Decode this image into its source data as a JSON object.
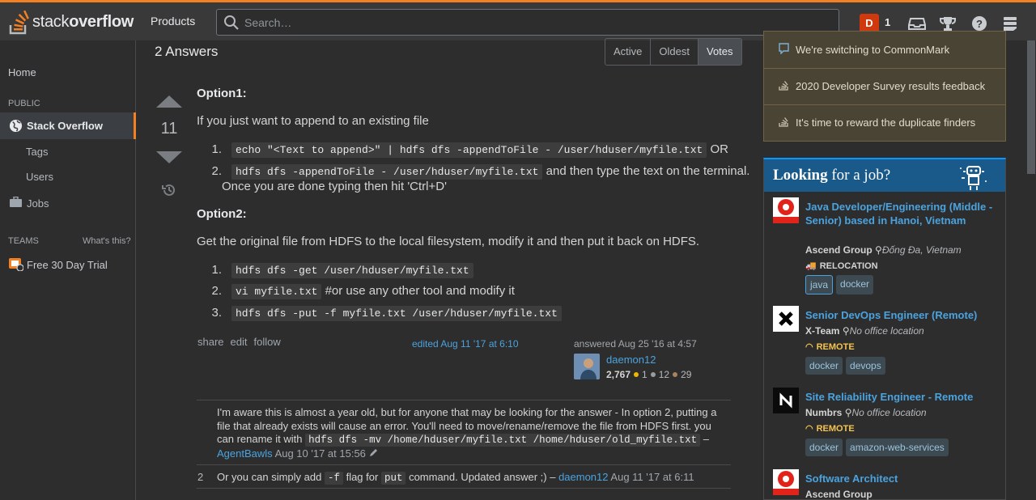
{
  "topbar": {
    "logo_light": "stack",
    "logo_bold": "overflow",
    "products": "Products",
    "search_placeholder": "Search…",
    "user_initial": "D",
    "reputation": "1"
  },
  "leftnav": {
    "home": "Home",
    "public": "PUBLIC",
    "stack_overflow": "Stack Overflow",
    "tags": "Tags",
    "users": "Users",
    "jobs": "Jobs",
    "teams": "TEAMS",
    "whats_this": "What's this?",
    "free_trial": "Free 30 Day Trial"
  },
  "answers": {
    "title": "2 Answers",
    "sort": [
      "Active",
      "Oldest",
      "Votes"
    ],
    "active_sort": "Votes"
  },
  "answer": {
    "score": "11",
    "option1_heading": "Option1:",
    "option1_intro": "If you just want to append to an existing file",
    "opt1_item1_code": "echo \"<Text to append>\" | hdfs dfs -appendToFile - /user/hduser/myfile.txt",
    "opt1_item1_after": " OR",
    "opt1_item2_code": "hdfs dfs -appendToFile - /user/hduser/myfile.txt",
    "opt1_item2_after": " and then type the text on the terminal.",
    "opt1_item2_cont": "Once you are done typing then hit 'Ctrl+D'",
    "option2_heading": "Option2:",
    "option2_intro": "Get the original file from HDFS to the local filesystem, modify it and then put it back on HDFS.",
    "opt2_item1_code": "hdfs dfs -get /user/hduser/myfile.txt",
    "opt2_item2_code": "vi myfile.txt",
    "opt2_item2_after": " #or use any other tool and modify it",
    "opt2_item3_code": "hdfs dfs -put -f myfile.txt /user/hduser/myfile.txt",
    "menu": [
      "share",
      "edit",
      "follow"
    ],
    "edited": "edited Aug 11 '17 at 6:10",
    "answered": "answered Aug 25 '16 at 4:57",
    "user_name": "daemon12",
    "user_rep": "2,767",
    "gold": "1",
    "silver": "12",
    "bronze": "29"
  },
  "comments": [
    {
      "score": "",
      "text_a": "I'm aware this is almost a year old, but for anyone that may be looking for the answer - In option 2, putting a file that already exists will cause an error. You'll need to move/rename/remove the file from HDFS first. you can rename it with ",
      "code": "hdfs dfs -mv /home/hduser/myfile.txt /home/hduser/old_myfile.txt",
      "text_b": " –",
      "user": "AgentBawls",
      "date": "Aug 10 '17 at 15:56"
    },
    {
      "score": "2",
      "text_a": "Or you can simply add ",
      "code1": "-f",
      "text_b": " flag for ",
      "code2": "put",
      "text_c": " command. Updated answer ;) –",
      "user": "daemon12",
      "date": "Aug 11 '17 at 6:11"
    }
  ],
  "meta": [
    {
      "icon": "speech-bubble-icon",
      "text": "We're switching to CommonMark"
    },
    {
      "icon": "stack-icon",
      "text": "2020 Developer Survey results feedback"
    },
    {
      "icon": "stack-icon",
      "text": "It's time to reward the duplicate finders"
    }
  ],
  "jobs": {
    "heading_bold": "Looking",
    "heading_rest": " for a job?",
    "items": [
      {
        "title": "Java Developer/Engineering (Middle - Senior) based in Hanoi, Vietnam",
        "company": "Ascend Group",
        "location": "Đống Đa, Vietnam",
        "perk": "RELOCATION",
        "tags": [
          "java",
          "docker"
        ]
      },
      {
        "title": "Senior DevOps Engineer (Remote)",
        "company": "X-Team",
        "location": "No office location",
        "perk": "REMOTE",
        "tags": [
          "docker",
          "devops"
        ]
      },
      {
        "title": "Site Reliability Engineer - Remote",
        "company": "Numbrs",
        "location": "No office location",
        "perk": "REMOTE",
        "tags": [
          "docker",
          "amazon-web-services"
        ]
      },
      {
        "title": "Software Architect",
        "company": "Ascend Group",
        "location": "",
        "perk": "",
        "tags": []
      }
    ]
  },
  "colors": {
    "accent": "#f48024",
    "link": "#4aa3df",
    "background": "#2d2d2d",
    "topbar": "#393939"
  }
}
